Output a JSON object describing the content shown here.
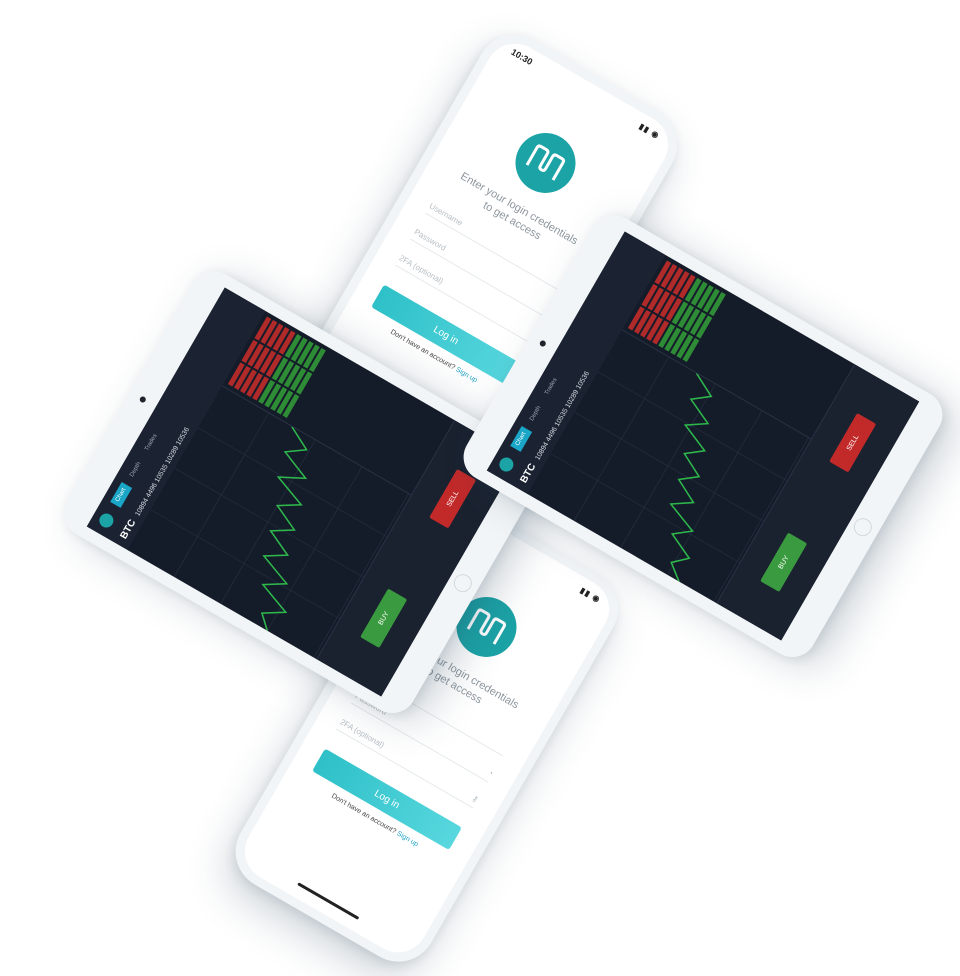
{
  "login": {
    "time": "10:30",
    "prompt_line1": "Enter your login credentials",
    "prompt_line2": "to get access",
    "username_placeholder": "Username",
    "password_placeholder": "Password",
    "otp_placeholder": "2FA (optional)",
    "login_label": "Log in",
    "no_account": "Don't have an account?",
    "signup_label": "Sign up"
  },
  "trading": {
    "pair": "BTC",
    "stats": "10894 4496 10535 10289 10536",
    "tabs": [
      "Chart",
      "Depth",
      "Trades"
    ],
    "buy_label": "BUY",
    "sell_label": "SELL"
  },
  "colors": {
    "brand": "#1ba3a6",
    "accent": "#2ec0c8",
    "bid": "#2f8c36",
    "ask": "#b12a2a",
    "screen_bg": "#141c29"
  }
}
